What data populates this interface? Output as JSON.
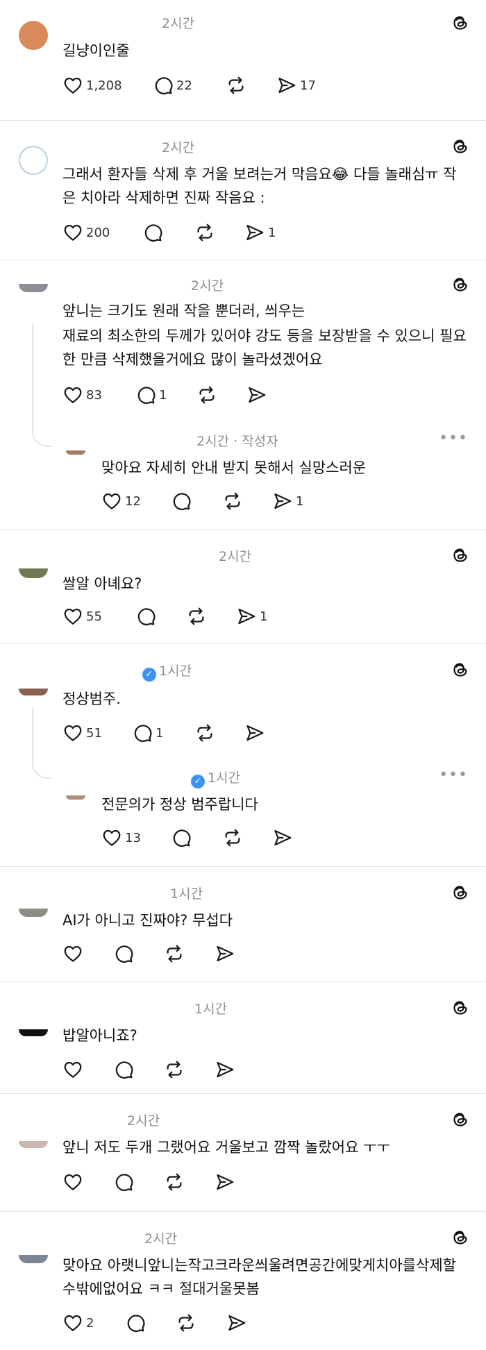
{
  "posts": [
    {
      "time": "2시간",
      "text": "길냥이인줄",
      "likes": "1,208",
      "replies": "22",
      "reposts": "",
      "shares": "17"
    },
    {
      "time": "2시간",
      "text_line1": "그래서 환자들 삭제 후 거울 보려는거 막음요😂 다들 놀래심ㅠ 작",
      "text_line2": "은 치아라 삭제하면 진짜 작음요 :",
      "likes": "200",
      "replies": "",
      "reposts": "",
      "shares": "1"
    },
    {
      "time": "2시간",
      "text_line1": "앞니는 크기도 원래 작을 뿐더러, 씌우는",
      "text_line2": "재료의 최소한의 두께가 있어야 강도 등을 보장받을 수 있으니 필요",
      "text_line3": "한 만큼 삭제했을거에요 많이 놀라셨겠어요",
      "likes": "83",
      "replies": "1",
      "reposts": "",
      "shares": "",
      "reply": {
        "time": "2시간 · 작성자",
        "more": "•••",
        "text": "맞아요 자세히 안내 받지 못해서 실망스러운",
        "likes": "12",
        "replies": "",
        "reposts": "",
        "shares": "1"
      }
    },
    {
      "time": "2시간",
      "text": "쌀알 아녜요?",
      "likes": "55",
      "replies": "",
      "reposts": "",
      "shares": "1"
    },
    {
      "time": "1시간",
      "verified": "✓",
      "text": "정상범주.",
      "likes": "51",
      "replies": "1",
      "reposts": "",
      "shares": "",
      "reply": {
        "time": "1시간",
        "verified": "✓",
        "more": "•••",
        "text": "전문의가 정상 범주랍니다",
        "likes": "13",
        "replies": "",
        "reposts": "",
        "shares": ""
      }
    },
    {
      "time": "1시간",
      "text": "AI가 아니고 진짜야? 무섭다",
      "likes": "",
      "replies": "",
      "reposts": "",
      "shares": ""
    },
    {
      "time": "1시간",
      "text": "밥알아니죠?",
      "likes": "",
      "replies": "",
      "reposts": "",
      "shares": ""
    },
    {
      "time": "2시간",
      "text": "앞니 저도 두개 그랬어요  거울보고 깜짝 놀랐어요 ㅜㅜ",
      "likes": "",
      "replies": "",
      "reposts": "",
      "shares": ""
    },
    {
      "time": "2시간",
      "text_line1": "맞아요 아랫니앞니는작고크라운씌울려면공간에맞게치아를삭제할",
      "text_line2": "수밖에없어요 ㅋㅋ 절대거울못봄",
      "likes": "2",
      "replies": "",
      "reposts": "",
      "shares": ""
    }
  ],
  "icons": {
    "like": "heart-icon",
    "reply": "comment-icon",
    "repost": "repost-icon",
    "share": "send-icon",
    "logo": "threads-logo-icon",
    "more": "more-icon"
  }
}
